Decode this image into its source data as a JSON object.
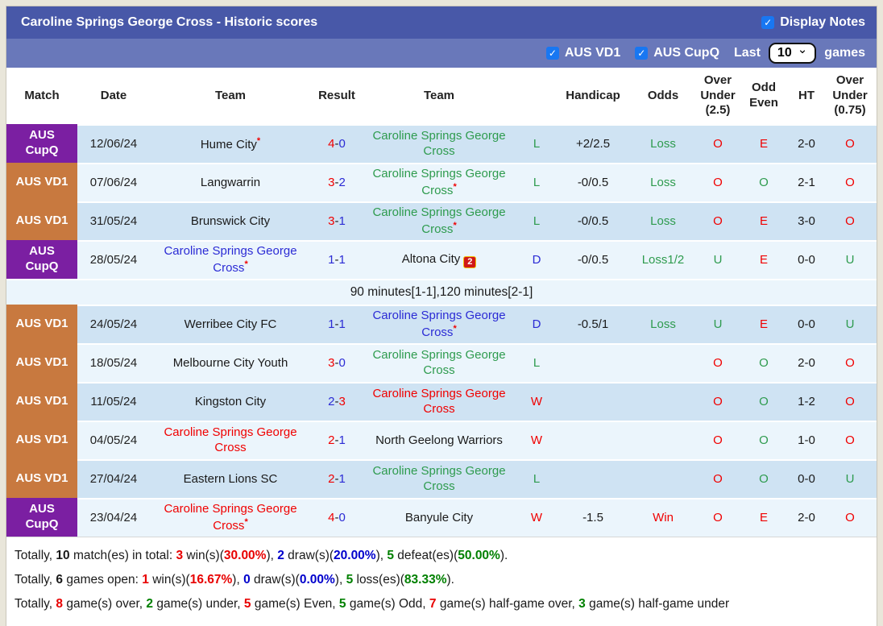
{
  "title_bar": {
    "title": "Caroline Springs George Cross - Historic scores",
    "display_notes_label": "Display Notes"
  },
  "filter_bar": {
    "league1_label": "AUS VD1",
    "league2_label": "AUS CupQ",
    "last_label": "Last",
    "games_label": "games",
    "selected_count": "10"
  },
  "icons": {
    "star": "*",
    "extra_time": "2",
    "checkmark": "✓"
  },
  "colors": {
    "accent_red": "#f00000",
    "accent_blue": "#2b2bd5",
    "accent_green": "#2e9b4e",
    "badge_cupq": "#7b1fa2",
    "badge_vd1": "#c8793f",
    "row_blue": "#cfe3f3",
    "row_light": "#ebf5fc",
    "bar_dark": "#4858a8",
    "bar_light": "#6978ba",
    "checkbox_blue": "#1877f2"
  },
  "table": {
    "headers": [
      "Match",
      "Date",
      "Team",
      "Result",
      "Team",
      "",
      "Handicap",
      "Odds",
      "Over Under (2.5)",
      "Odd Even",
      "HT",
      "Over Under (0.75)"
    ],
    "note": {
      "after_row": 4,
      "text": "90 minutes[1-1],120 minutes[2-1]"
    },
    "rows": [
      {
        "league": "AUS CupQ",
        "league_key": "cupq",
        "date": "12/06/24",
        "home": {
          "name": "Hume City",
          "color": "black",
          "star": true
        },
        "score": {
          "home": "4",
          "away": "0",
          "home_color": "red",
          "away_color": "blue"
        },
        "away": {
          "name": "Caroline Springs George Cross",
          "color": "green"
        },
        "wdl": {
          "text": "L",
          "color": "green"
        },
        "handicap": "+2/2.5",
        "odds": {
          "text": "Loss",
          "color": "green"
        },
        "ou25": {
          "text": "O",
          "color": "red"
        },
        "oe": {
          "text": "E",
          "color": "red"
        },
        "ht": "2-0",
        "ou075": {
          "text": "O",
          "color": "red"
        }
      },
      {
        "league": "AUS VD1",
        "league_key": "vd1",
        "date": "07/06/24",
        "home": {
          "name": "Langwarrin",
          "color": "black"
        },
        "score": {
          "home": "3",
          "away": "2",
          "home_color": "red",
          "away_color": "blue"
        },
        "away": {
          "name": "Caroline Springs George Cross",
          "color": "green",
          "star": true
        },
        "wdl": {
          "text": "L",
          "color": "green"
        },
        "handicap": "-0/0.5",
        "odds": {
          "text": "Loss",
          "color": "green"
        },
        "ou25": {
          "text": "O",
          "color": "red"
        },
        "oe": {
          "text": "O",
          "color": "green"
        },
        "ht": "2-1",
        "ou075": {
          "text": "O",
          "color": "red"
        }
      },
      {
        "league": "AUS VD1",
        "league_key": "vd1",
        "date": "31/05/24",
        "home": {
          "name": "Brunswick City",
          "color": "black"
        },
        "score": {
          "home": "3",
          "away": "1",
          "home_color": "red",
          "away_color": "blue"
        },
        "away": {
          "name": "Caroline Springs George Cross",
          "color": "green",
          "star": true
        },
        "wdl": {
          "text": "L",
          "color": "green"
        },
        "handicap": "-0/0.5",
        "odds": {
          "text": "Loss",
          "color": "green"
        },
        "ou25": {
          "text": "O",
          "color": "red"
        },
        "oe": {
          "text": "E",
          "color": "red"
        },
        "ht": "3-0",
        "ou075": {
          "text": "O",
          "color": "red"
        }
      },
      {
        "league": "AUS CupQ",
        "league_key": "cupq",
        "date": "28/05/24",
        "home": {
          "name": "Caroline Springs George Cross",
          "color": "blue",
          "star": true
        },
        "score": {
          "home": "1",
          "away": "1",
          "home_color": "blue",
          "away_color": "blue"
        },
        "away": {
          "name": "Altona City",
          "color": "black",
          "icon": true
        },
        "wdl": {
          "text": "D",
          "color": "blue"
        },
        "handicap": "-0/0.5",
        "odds": {
          "text": "Loss1/2",
          "color": "green"
        },
        "ou25": {
          "text": "U",
          "color": "green"
        },
        "oe": {
          "text": "E",
          "color": "red"
        },
        "ht": "0-0",
        "ou075": {
          "text": "U",
          "color": "green"
        }
      },
      {
        "league": "AUS VD1",
        "league_key": "vd1",
        "date": "24/05/24",
        "home": {
          "name": "Werribee City FC",
          "color": "black"
        },
        "score": {
          "home": "1",
          "away": "1",
          "home_color": "blue",
          "away_color": "blue"
        },
        "away": {
          "name": "Caroline Springs George Cross",
          "color": "blue",
          "star": true
        },
        "wdl": {
          "text": "D",
          "color": "blue"
        },
        "handicap": "-0.5/1",
        "odds": {
          "text": "Loss",
          "color": "green"
        },
        "ou25": {
          "text": "U",
          "color": "green"
        },
        "oe": {
          "text": "E",
          "color": "red"
        },
        "ht": "0-0",
        "ou075": {
          "text": "U",
          "color": "green"
        }
      },
      {
        "league": "AUS VD1",
        "league_key": "vd1",
        "date": "18/05/24",
        "home": {
          "name": "Melbourne City Youth",
          "color": "black"
        },
        "score": {
          "home": "3",
          "away": "0",
          "home_color": "red",
          "away_color": "blue"
        },
        "away": {
          "name": "Caroline Springs George Cross",
          "color": "green"
        },
        "wdl": {
          "text": "L",
          "color": "green"
        },
        "handicap": "",
        "odds": {
          "text": "",
          "color": "black"
        },
        "ou25": {
          "text": "O",
          "color": "red"
        },
        "oe": {
          "text": "O",
          "color": "green"
        },
        "ht": "2-0",
        "ou075": {
          "text": "O",
          "color": "red"
        }
      },
      {
        "league": "AUS VD1",
        "league_key": "vd1",
        "date": "11/05/24",
        "home": {
          "name": "Kingston City",
          "color": "black"
        },
        "score": {
          "home": "2",
          "away": "3",
          "home_color": "blue",
          "away_color": "red"
        },
        "away": {
          "name": "Caroline Springs George Cross",
          "color": "red"
        },
        "wdl": {
          "text": "W",
          "color": "red"
        },
        "handicap": "",
        "odds": {
          "text": "",
          "color": "black"
        },
        "ou25": {
          "text": "O",
          "color": "red"
        },
        "oe": {
          "text": "O",
          "color": "green"
        },
        "ht": "1-2",
        "ou075": {
          "text": "O",
          "color": "red"
        }
      },
      {
        "league": "AUS VD1",
        "league_key": "vd1",
        "date": "04/05/24",
        "home": {
          "name": "Caroline Springs George Cross",
          "color": "red"
        },
        "score": {
          "home": "2",
          "away": "1",
          "home_color": "red",
          "away_color": "blue"
        },
        "away": {
          "name": "North Geelong Warriors",
          "color": "black"
        },
        "wdl": {
          "text": "W",
          "color": "red"
        },
        "handicap": "",
        "odds": {
          "text": "",
          "color": "black"
        },
        "ou25": {
          "text": "O",
          "color": "red"
        },
        "oe": {
          "text": "O",
          "color": "green"
        },
        "ht": "1-0",
        "ou075": {
          "text": "O",
          "color": "red"
        }
      },
      {
        "league": "AUS VD1",
        "league_key": "vd1",
        "date": "27/04/24",
        "home": {
          "name": "Eastern Lions SC",
          "color": "black"
        },
        "score": {
          "home": "2",
          "away": "1",
          "home_color": "red",
          "away_color": "blue"
        },
        "away": {
          "name": "Caroline Springs George Cross",
          "color": "green"
        },
        "wdl": {
          "text": "L",
          "color": "green"
        },
        "handicap": "",
        "odds": {
          "text": "",
          "color": "black"
        },
        "ou25": {
          "text": "O",
          "color": "red"
        },
        "oe": {
          "text": "O",
          "color": "green"
        },
        "ht": "0-0",
        "ou075": {
          "text": "U",
          "color": "green"
        }
      },
      {
        "league": "AUS CupQ",
        "league_key": "cupq",
        "date": "23/04/24",
        "home": {
          "name": "Caroline Springs George Cross",
          "color": "red",
          "star": true
        },
        "score": {
          "home": "4",
          "away": "0",
          "home_color": "red",
          "away_color": "blue"
        },
        "away": {
          "name": "Banyule City",
          "color": "black"
        },
        "wdl": {
          "text": "W",
          "color": "red"
        },
        "handicap": "-1.5",
        "odds": {
          "text": "Win",
          "color": "red"
        },
        "ou25": {
          "text": "O",
          "color": "red"
        },
        "oe": {
          "text": "E",
          "color": "red"
        },
        "ht": "2-0",
        "ou075": {
          "text": "O",
          "color": "red"
        }
      }
    ]
  },
  "footer_lines": [
    [
      {
        "t": "Totally, ",
        "c": "black"
      },
      {
        "t": "10",
        "c": "black",
        "b": 1
      },
      {
        "t": " match(es) in total: ",
        "c": "black"
      },
      {
        "t": "3",
        "c": "red",
        "b": 1
      },
      {
        "t": " win(s)(",
        "c": "black"
      },
      {
        "t": "30.00%",
        "c": "red",
        "b": 1
      },
      {
        "t": "), ",
        "c": "black"
      },
      {
        "t": "2",
        "c": "blue",
        "b": 1
      },
      {
        "t": " draw(s)(",
        "c": "black"
      },
      {
        "t": "20.00%",
        "c": "blue",
        "b": 1
      },
      {
        "t": "), ",
        "c": "black"
      },
      {
        "t": "5",
        "c": "green",
        "b": 1
      },
      {
        "t": " defeat(es)(",
        "c": "black"
      },
      {
        "t": "50.00%",
        "c": "green",
        "b": 1
      },
      {
        "t": ").",
        "c": "black"
      }
    ],
    [
      {
        "t": "Totally, ",
        "c": "black"
      },
      {
        "t": "6",
        "c": "black",
        "b": 1
      },
      {
        "t": " games open: ",
        "c": "black"
      },
      {
        "t": "1",
        "c": "red",
        "b": 1
      },
      {
        "t": " win(s)(",
        "c": "black"
      },
      {
        "t": "16.67%",
        "c": "red",
        "b": 1
      },
      {
        "t": "), ",
        "c": "black"
      },
      {
        "t": "0",
        "c": "blue",
        "b": 1
      },
      {
        "t": " draw(s)(",
        "c": "black"
      },
      {
        "t": "0.00%",
        "c": "blue",
        "b": 1
      },
      {
        "t": "), ",
        "c": "black"
      },
      {
        "t": "5",
        "c": "green",
        "b": 1
      },
      {
        "t": " loss(es)(",
        "c": "black"
      },
      {
        "t": "83.33%",
        "c": "green",
        "b": 1
      },
      {
        "t": ").",
        "c": "black"
      }
    ],
    [
      {
        "t": "Totally, ",
        "c": "black"
      },
      {
        "t": "8",
        "c": "red",
        "b": 1
      },
      {
        "t": " game(s) over, ",
        "c": "black"
      },
      {
        "t": "2",
        "c": "green",
        "b": 1
      },
      {
        "t": " game(s) under, ",
        "c": "black"
      },
      {
        "t": "5",
        "c": "red",
        "b": 1
      },
      {
        "t": " game(s) Even, ",
        "c": "black"
      },
      {
        "t": "5",
        "c": "green",
        "b": 1
      },
      {
        "t": " game(s) Odd, ",
        "c": "black"
      },
      {
        "t": "7",
        "c": "red",
        "b": 1
      },
      {
        "t": " game(s) half-game over, ",
        "c": "black"
      },
      {
        "t": "3",
        "c": "green",
        "b": 1
      },
      {
        "t": " game(s) half-game under",
        "c": "black"
      }
    ]
  ]
}
